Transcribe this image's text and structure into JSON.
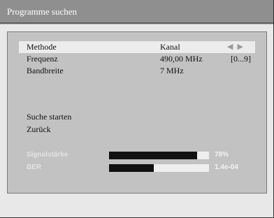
{
  "window": {
    "title": "Programme suchen"
  },
  "settings": [
    {
      "label": "Methode",
      "value": "Kanal",
      "extra": "",
      "selected": true
    },
    {
      "label": "Frequenz",
      "value": "490,00 MHz",
      "extra": "[0...9]",
      "selected": false
    },
    {
      "label": "Bandbreite",
      "value": "7 MHz",
      "extra": "",
      "selected": false
    }
  ],
  "actions": {
    "start": "Suche starten",
    "back": "Zurück"
  },
  "meters": [
    {
      "label": "Signalstärke",
      "value_text": "78%",
      "level": 0.88
    },
    {
      "label": "BER",
      "value_text": "1.4e-04",
      "level": 0.45
    }
  ],
  "icons": {
    "left_arrow": "arrow-left-icon",
    "right_arrow": "arrow-right-icon"
  },
  "colors": {
    "titlebar": "#8f8f8f",
    "panel": "#c2c2c2",
    "selected_row": "#ececec",
    "meter_fill": "#111111"
  }
}
